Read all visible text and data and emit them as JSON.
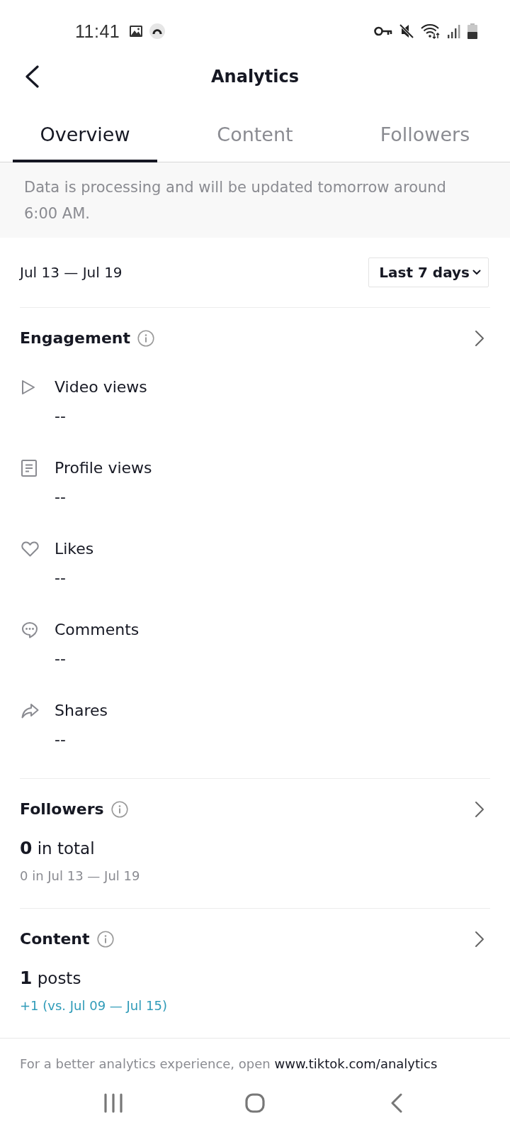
{
  "status_bar": {
    "time": "11:41"
  },
  "header": {
    "title": "Analytics"
  },
  "tabs": [
    {
      "label": "Overview",
      "selected": true
    },
    {
      "label": "Content",
      "selected": false
    },
    {
      "label": "Followers",
      "selected": false
    }
  ],
  "notice": "Data is processing and will be updated tomorrow around 6:00 AM.",
  "date_range": {
    "label": "Jul 13 — Jul 19",
    "period": "Last 7 days"
  },
  "sections": [
    {
      "kind": "metrics",
      "title": "Engagement",
      "metrics": [
        {
          "label": "Video views",
          "value": "--"
        },
        {
          "label": "Profile views",
          "value": "--"
        },
        {
          "label": "Likes",
          "value": "--"
        },
        {
          "label": "Comments",
          "value": "--"
        },
        {
          "label": "Shares",
          "value": "--"
        }
      ]
    },
    {
      "kind": "summary",
      "title": "Followers",
      "total": "**0** in total",
      "detail": "0 in Jul 13 — Jul 19",
      "highlighted": false
    },
    {
      "kind": "summary",
      "title": "Content",
      "total": "**1** posts",
      "detail": "+1 (vs. Jul 09 — Jul 15)",
      "highlighted": true
    }
  ],
  "footer": {
    "text": "For a better analytics experience, open",
    "link": "www.tiktok.com/analytics"
  }
}
